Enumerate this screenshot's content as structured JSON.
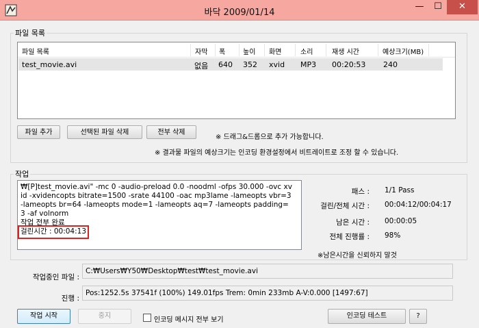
{
  "window": {
    "title": "바닥 2009/01/14",
    "minimize": "—",
    "maximize": "☐",
    "close": "✕"
  },
  "file_group": {
    "label": "파일 목록",
    "columns": [
      "파일 목록",
      "자막",
      "폭",
      "높이",
      "화면",
      "소리",
      "재생 시간",
      "예상크기(MB)"
    ],
    "rows": [
      [
        "test_movie.avi",
        "없음",
        "640",
        "352",
        "xvid",
        "MP3",
        "00:20:53",
        "240"
      ]
    ],
    "add_button": "파일 추가",
    "remove_selected_button": "선택된 파일 삭제",
    "remove_all_button": "전부 삭제",
    "note_drag": "※ 드래그&드롭으로 추가 가능합니다.",
    "note_size": "※ 결과물 파일의 예상크기는 인코딩 환경설정에서 비트레이트로 조정 할 수 있습니다."
  },
  "work_group": {
    "label": "작업",
    "log_lines": [
      "₩[P]test_movie.avi\" -mc 0 -audio-preload 0.0 -noodml -ofps 30.000 -ovc xvid -xvidencopts bitrate=1500 -srate 44100 -oac mp3lame -lameopts vbr=3 -lameopts br=64 -lameopts mode=1 -lameopts aq=7 -lameopts padding=3 -af volnorm",
      "작업 전부 완료",
      "걸린시간 : 00:04:13"
    ],
    "stats": [
      {
        "label": "패스 :",
        "value": "1/1 Pass"
      },
      {
        "label": "걸린/전체 시간 :",
        "value": "00:04:12/00:04:17"
      },
      {
        "label": "남은 시간 :",
        "value": "00:00:05"
      },
      {
        "label": "전체 진행률 :",
        "value": "98%"
      }
    ],
    "note_remaining": "※남은시간을 신뢰하지 말것"
  },
  "current_file": {
    "label": "작업중인 파일 :",
    "value": "C:₩Users₩Y50₩Desktop₩test₩test_movie.avi"
  },
  "progress": {
    "label": "진행 :",
    "value": "Pos:1252.5s  37541f (100%) 149.01fps Trem:    0min 233mb  A-V:0.000 [1497:67]"
  },
  "footer": {
    "start_button": "작업 시작",
    "stop_button": "중지",
    "show_all_messages": "인코딩 메시지 전부 보기",
    "show_all_checked": false,
    "encoding_test_button": "인코딩 테스트",
    "help_button": "?"
  },
  "colors": {
    "titlebar": "#f5a7a0",
    "close": "#c7504a",
    "highlight": "#e0201f",
    "selected_row": "#e5e5e5"
  }
}
